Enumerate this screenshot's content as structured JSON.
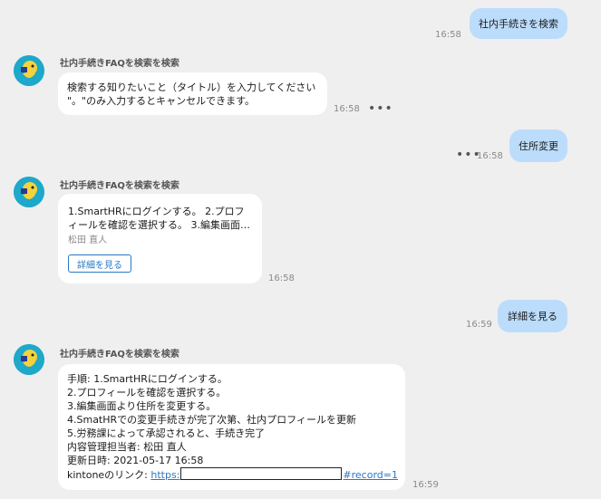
{
  "messages": {
    "user1": {
      "text": "社内手続きを検索",
      "time": "16:58"
    },
    "bot1": {
      "sender": "社内手続きFAQを検索を検索",
      "line1": "検索する知りたいこと（タイトル）を入力してください",
      "line2": "\"。\"のみ入力するとキャンセルできます。",
      "time": "16:58",
      "more": "•••"
    },
    "user2": {
      "text": "住所変更",
      "time": "16:58",
      "more": "•••"
    },
    "bot2": {
      "sender": "社内手続きFAQを検索を検索",
      "line1": "1.SmartHRにログインする。 2.プロフ",
      "line2": "ィールを確認を選択する。 3.編集画面…",
      "author": "松田 直人",
      "button": "詳細を見る",
      "time": "16:58"
    },
    "user3": {
      "text": "詳細を見る",
      "time": "16:59"
    },
    "bot3": {
      "sender": "社内手続きFAQを検索を検索",
      "lines": [
        "手順: 1.SmartHRにログインする。",
        "2.プロフィールを確認を選択する。",
        "3.編集画面より住所を変更する。",
        "4.SmatHRでの変更手続きが完了次第、社内プロフィールを更新",
        "5.労務課によって承認されると、手続き完了",
        "内容管理担当者: 松田 直人",
        "更新日時: 2021-05-17 16:58"
      ],
      "link_prefix": "kintoneのリンク: ",
      "link_start": "https:",
      "link_end": "#record=1",
      "time": "16:59"
    }
  },
  "colors": {
    "background": "#efeff0",
    "user_bubble": "#bcdcfb",
    "bot_bubble": "#ffffff",
    "link": "#2a78c5",
    "avatar_bg": "#1ea8c9"
  },
  "icons": {
    "avatar": "bot-avatar-icon"
  }
}
